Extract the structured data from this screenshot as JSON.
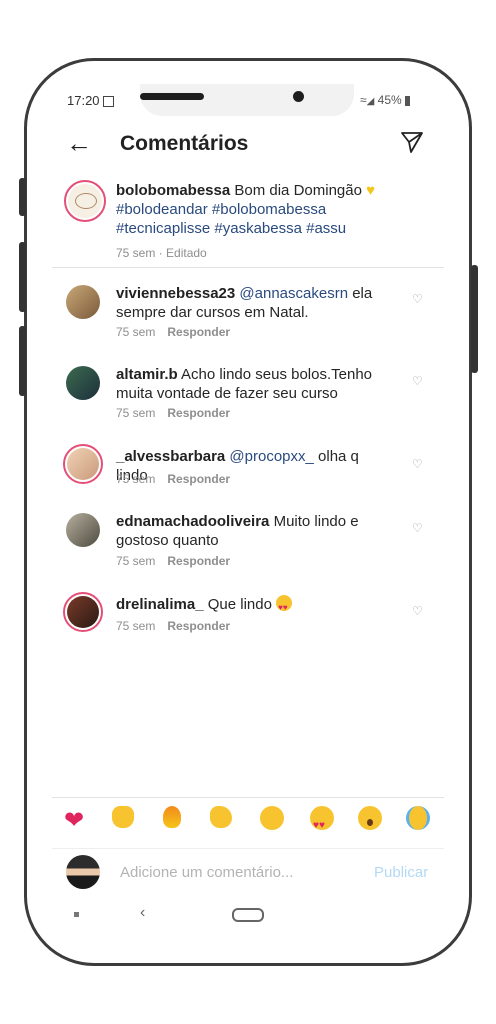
{
  "status": {
    "time": "17:20",
    "battery": "45%"
  },
  "header": {
    "title": "Comentários"
  },
  "caption": {
    "username": "bolobomabessa",
    "text": "Bom dia Domingão",
    "hashtags": "#bolodeandar #bolobomabessa #tecnicaplisse #yaskabessa #assu",
    "meta": "75 sem · Editado"
  },
  "comments": [
    {
      "username": "viviennebessa23",
      "mention": "@annascakesrn",
      "text": "ela sempre dar cursos em Natal.",
      "time": "75 sem",
      "reply": "Responder"
    },
    {
      "username": "altamir.b",
      "mention": "",
      "text": "Acho lindo seus bolos.Tenho muita vontade de fazer seu curso",
      "time": "75 sem",
      "reply": "Responder"
    },
    {
      "username": "_alvessbarbara",
      "mention": "@procopxx_",
      "text": "olha q lindo",
      "time": "75 sem",
      "reply": "Responder"
    },
    {
      "username": "ednamachadooliveira",
      "mention": "",
      "text": "Muito lindo e gostoso quanto",
      "time": "75 sem",
      "reply": "Responder"
    },
    {
      "username": "drelinalima_",
      "mention": "",
      "text": "Que lindo",
      "time": "75 sem",
      "reply": "Responder"
    }
  ],
  "emojis": [
    "heart",
    "raised-hands",
    "fire",
    "clapping-hands",
    "crying-face",
    "heart-eyes",
    "surprised-face",
    "laughing-tears"
  ],
  "input": {
    "placeholder": "Adicione um comentário...",
    "publish": "Publicar"
  },
  "colors": {
    "accent_ring": "#e44f77",
    "hashtag": "#2a4a7f",
    "publish": "#b3d9f5"
  }
}
